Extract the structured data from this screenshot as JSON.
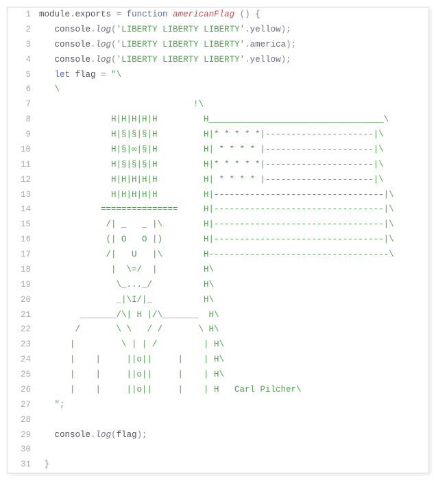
{
  "lines": [
    {
      "n": 1,
      "spans": [
        [
          "id",
          "module"
        ],
        [
          "op",
          "."
        ],
        [
          "id",
          "exports"
        ],
        [
          "plain",
          " "
        ],
        [
          "op",
          "="
        ],
        [
          "plain",
          " "
        ],
        [
          "kw",
          "function"
        ],
        [
          "plain",
          " "
        ],
        [
          "fn",
          "americanFlag"
        ],
        [
          "plain",
          " "
        ],
        [
          "punc",
          "()"
        ],
        [
          "plain",
          " "
        ],
        [
          "punc",
          "{"
        ]
      ]
    },
    {
      "n": 2,
      "spans": [
        [
          "plain",
          "   "
        ],
        [
          "id",
          "console"
        ],
        [
          "op",
          "."
        ],
        [
          "call",
          "log"
        ],
        [
          "punc",
          "("
        ],
        [
          "str",
          "'LIBERTY LIBERTY LIBERTY'"
        ],
        [
          "op",
          "."
        ],
        [
          "prop",
          "yellow"
        ],
        [
          "punc",
          ");"
        ]
      ]
    },
    {
      "n": 3,
      "spans": [
        [
          "plain",
          "   "
        ],
        [
          "id",
          "console"
        ],
        [
          "op",
          "."
        ],
        [
          "call",
          "log"
        ],
        [
          "punc",
          "("
        ],
        [
          "str",
          "'LIBERTY LIBERTY LIBERTY'"
        ],
        [
          "op",
          "."
        ],
        [
          "prop",
          "america"
        ],
        [
          "punc",
          ");"
        ]
      ]
    },
    {
      "n": 4,
      "spans": [
        [
          "plain",
          "   "
        ],
        [
          "id",
          "console"
        ],
        [
          "op",
          "."
        ],
        [
          "call",
          "log"
        ],
        [
          "punc",
          "("
        ],
        [
          "str",
          "'LIBERTY LIBERTY LIBERTY'"
        ],
        [
          "op",
          "."
        ],
        [
          "prop",
          "yellow"
        ],
        [
          "punc",
          ");"
        ]
      ]
    },
    {
      "n": 5,
      "spans": [
        [
          "plain",
          "   "
        ],
        [
          "kw",
          "let"
        ],
        [
          "plain",
          " "
        ],
        [
          "id",
          "flag"
        ],
        [
          "plain",
          " "
        ],
        [
          "op",
          "="
        ],
        [
          "plain",
          " "
        ],
        [
          "str",
          "\"\\"
        ]
      ]
    },
    {
      "n": 6,
      "spans": [
        [
          "str",
          "   \\"
        ]
      ]
    },
    {
      "n": 7,
      "spans": [
        [
          "str",
          "                              !\\"
        ]
      ]
    },
    {
      "n": 8,
      "spans": [
        [
          "str",
          "              H|H|H|H|H         H__________________________________\\"
        ]
      ]
    },
    {
      "n": 9,
      "spans": [
        [
          "str",
          "              H|§|§|§|H         H|* * * * *|---------------------|\\"
        ]
      ]
    },
    {
      "n": 10,
      "spans": [
        [
          "str",
          "              H|§|∞|§|H         H| * * * * |---------------------|\\"
        ]
      ]
    },
    {
      "n": 11,
      "spans": [
        [
          "str",
          "              H|§|§|§|H         H|* * * * *|---------------------|\\"
        ]
      ]
    },
    {
      "n": 12,
      "spans": [
        [
          "str",
          "              H|H|H|H|H         H| * * * * |---------------------|\\"
        ]
      ]
    },
    {
      "n": 13,
      "spans": [
        [
          "str",
          "              H|H|H|H|H         H|---------------------------------|\\"
        ]
      ]
    },
    {
      "n": 14,
      "spans": [
        [
          "str",
          "            ===============     H|---------------------------------|\\"
        ]
      ]
    },
    {
      "n": 15,
      "spans": [
        [
          "str",
          "             /| _   _ |\\        H|---------------------------------|\\"
        ]
      ]
    },
    {
      "n": 16,
      "spans": [
        [
          "str",
          "             (| O   O |)        H|---------------------------------|\\"
        ]
      ]
    },
    {
      "n": 17,
      "spans": [
        [
          "str",
          "             /|   U   |\\        H-----------------------------------\\"
        ]
      ]
    },
    {
      "n": 18,
      "spans": [
        [
          "str",
          "              |  \\=/  |         H\\"
        ]
      ]
    },
    {
      "n": 19,
      "spans": [
        [
          "str",
          "               \\_..._/          H\\"
        ]
      ]
    },
    {
      "n": 20,
      "spans": [
        [
          "str",
          "               _|\\I/|_          H\\"
        ]
      ]
    },
    {
      "n": 21,
      "spans": [
        [
          "str",
          "        _______/\\| H |/\\_______  H\\"
        ]
      ]
    },
    {
      "n": 22,
      "spans": [
        [
          "str",
          "       /       \\ \\   / /       \\ H\\"
        ]
      ]
    },
    {
      "n": 23,
      "spans": [
        [
          "str",
          "      |         \\ | | /         | H\\"
        ]
      ]
    },
    {
      "n": 24,
      "spans": [
        [
          "str",
          "      |    |     ||o||     |    | H\\"
        ]
      ]
    },
    {
      "n": 25,
      "spans": [
        [
          "str",
          "      |    |     ||o||     |    | H\\"
        ]
      ]
    },
    {
      "n": 26,
      "spans": [
        [
          "str",
          "      |    |     ||o||     |    | H   Carl Pilcher\\"
        ]
      ]
    },
    {
      "n": 27,
      "spans": [
        [
          "plain",
          "   "
        ],
        [
          "str",
          "\""
        ],
        [
          "punc",
          ";"
        ]
      ]
    },
    {
      "n": 28,
      "spans": [
        [
          "plain",
          " "
        ]
      ]
    },
    {
      "n": 29,
      "spans": [
        [
          "plain",
          "   "
        ],
        [
          "id",
          "console"
        ],
        [
          "op",
          "."
        ],
        [
          "call",
          "log"
        ],
        [
          "punc",
          "("
        ],
        [
          "id",
          "flag"
        ],
        [
          "punc",
          ");"
        ]
      ]
    },
    {
      "n": 30,
      "spans": [
        [
          "plain",
          " "
        ]
      ]
    },
    {
      "n": 31,
      "spans": [
        [
          "plain",
          " "
        ],
        [
          "punc",
          "}"
        ]
      ]
    }
  ]
}
